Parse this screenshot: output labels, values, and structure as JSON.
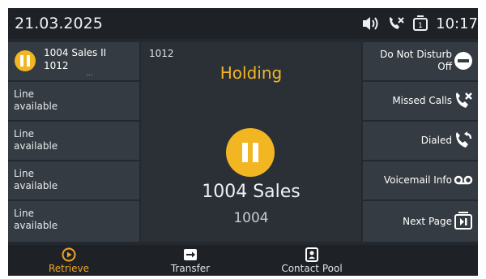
{
  "status": {
    "date": "21.03.2025",
    "time": "10:17",
    "icons": [
      "speaker-icon",
      "missed-call-icon",
      "line-1-icon"
    ],
    "line_key_number": "1"
  },
  "lines": {
    "active": {
      "name": "1004 Sales II",
      "number": "1012",
      "dots": "...",
      "icon": "pause-icon"
    },
    "available": [
      {
        "label": "Line available"
      },
      {
        "label": "Line available"
      },
      {
        "label": "Line available"
      },
      {
        "label": "Line available"
      }
    ]
  },
  "call": {
    "line": "1012",
    "state": "Holding",
    "icon": "pause-icon",
    "contact_name": "1004 Sales",
    "contact_number": "1004"
  },
  "functions": [
    {
      "label_1": "Do Not Disturb",
      "label_2": "Off",
      "icon": "do-not-disturb-icon"
    },
    {
      "label_1": "Missed Calls",
      "icon": "missed-calls-icon"
    },
    {
      "label_1": "Dialed",
      "icon": "dialed-calls-icon"
    },
    {
      "label_1": "Voicemail Info",
      "icon": "voicemail-icon"
    },
    {
      "label_1": "Next Page",
      "icon": "next-page-icon"
    }
  ],
  "softkeys": [
    {
      "label": "Retrieve",
      "icon": "retrieve-icon"
    },
    {
      "label": "Transfer",
      "icon": "transfer-icon"
    },
    {
      "label": "Contact Pool",
      "icon": "contact-pool-icon"
    }
  ],
  "colors": {
    "accent": "#f2b623",
    "softkey_active": "#f2a323",
    "background": "#24292f"
  }
}
